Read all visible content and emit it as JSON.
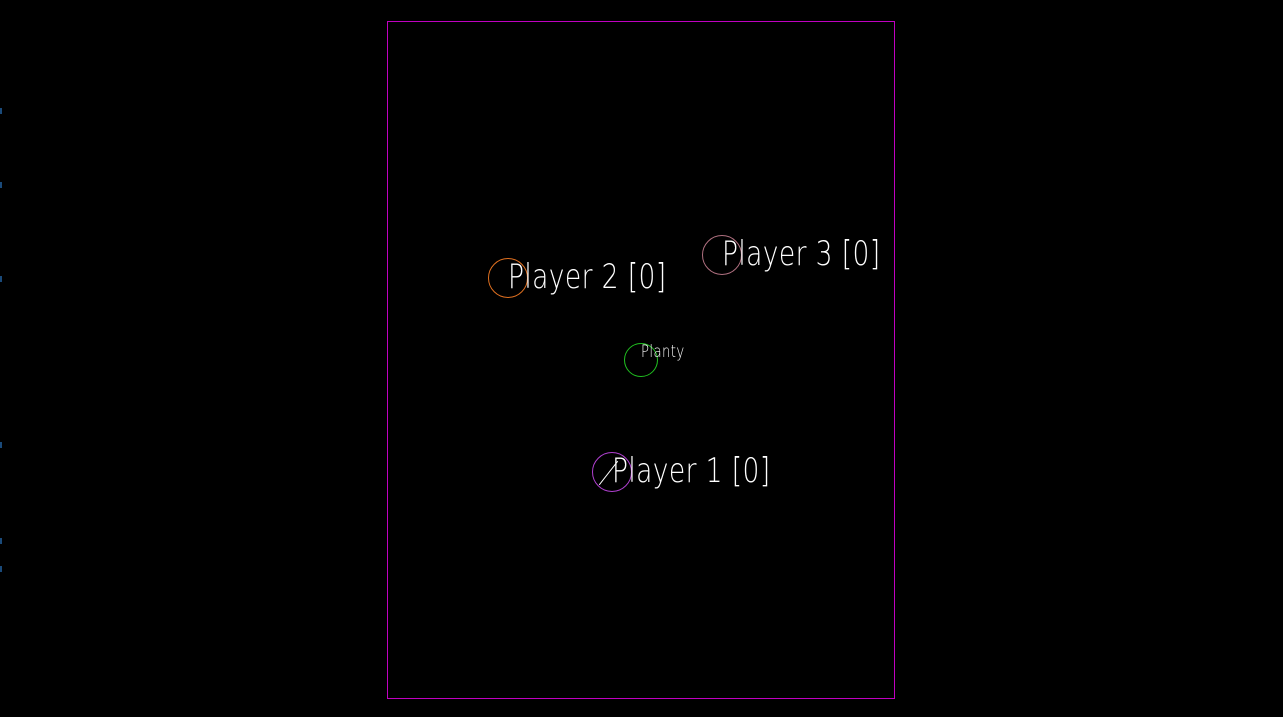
{
  "colors": {
    "background": "#000000",
    "arena_border": "#c000c0",
    "label_text": "#ffffff",
    "player1": "#b040d0",
    "player2": "#e07020",
    "player3": "#b07080",
    "planty": "#20c020"
  },
  "entities": {
    "player1": {
      "label": "Player 1 [0]",
      "score": 0
    },
    "player2": {
      "label": "Player 2 [0]",
      "score": 0
    },
    "player3": {
      "label": "Player 3 [0]",
      "score": 0
    },
    "planty": {
      "label": "Planty"
    }
  }
}
